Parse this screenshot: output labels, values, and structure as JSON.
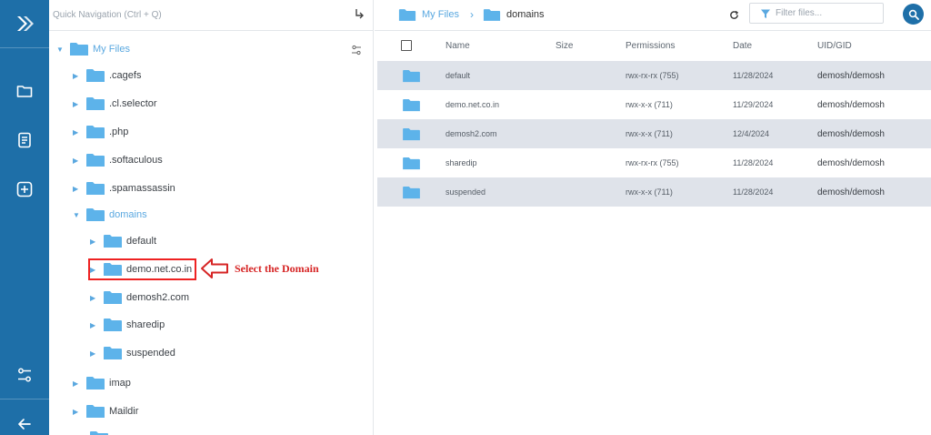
{
  "colors": {
    "rail": "#1e6fa8",
    "accent": "#5aa8e0",
    "folder": "#5db3ea",
    "row_alt": "#dfe3ea",
    "callout": "#d62525"
  },
  "rail": {
    "icons": [
      "logo-chevrons-icon",
      "folder-icon",
      "document-icon",
      "add-square-icon",
      "settings-nodes-icon",
      "back-arrow-icon"
    ]
  },
  "quick_nav": {
    "placeholder": "Quick Navigation (Ctrl + Q)"
  },
  "tree": {
    "root": {
      "label": "My Files"
    },
    "items": [
      {
        "label": ".cagefs"
      },
      {
        "label": ".cl.selector"
      },
      {
        "label": ".php"
      },
      {
        "label": ".softaculous"
      },
      {
        "label": ".spamassassin"
      },
      {
        "label": "domains"
      },
      {
        "label": "default"
      },
      {
        "label": "demo.net.co.in"
      },
      {
        "label": "demosh2.com"
      },
      {
        "label": "sharedip"
      },
      {
        "label": "suspended"
      },
      {
        "label": "imap"
      },
      {
        "label": "Maildir"
      }
    ]
  },
  "annotation": {
    "callout_text": "Select the Domain"
  },
  "breadcrumb": {
    "root": "My Files",
    "current": "domains"
  },
  "filter": {
    "placeholder": "Filter files..."
  },
  "table": {
    "headers": {
      "name": "Name",
      "size": "Size",
      "permissions": "Permissions",
      "date": "Date",
      "uid": "UID/GID"
    },
    "rows": [
      {
        "name": "default",
        "size": "",
        "permissions": "rwx-rx-rx (755)",
        "date": "11/28/2024",
        "uid": "demosh/demosh"
      },
      {
        "name": "demo.net.co.in",
        "size": "",
        "permissions": "rwx-x-x (711)",
        "date": "11/29/2024",
        "uid": "demosh/demosh"
      },
      {
        "name": "demosh2.com",
        "size": "",
        "permissions": "rwx-x-x (711)",
        "date": "12/4/2024",
        "uid": "demosh/demosh"
      },
      {
        "name": "sharedip",
        "size": "",
        "permissions": "rwx-rx-rx (755)",
        "date": "11/28/2024",
        "uid": "demosh/demosh"
      },
      {
        "name": "suspended",
        "size": "",
        "permissions": "rwx-x-x (711)",
        "date": "11/28/2024",
        "uid": "demosh/demosh"
      }
    ]
  }
}
